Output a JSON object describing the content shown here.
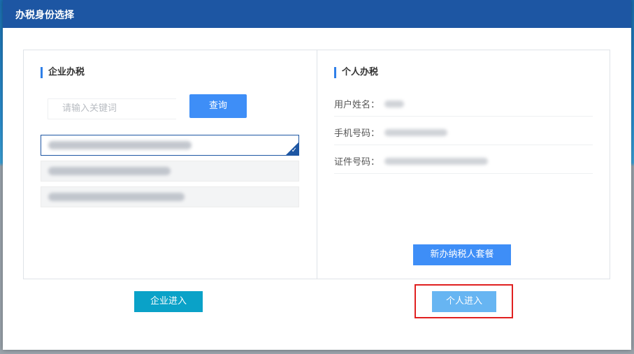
{
  "dialog": {
    "title": "办税身份选择"
  },
  "enterprise_panel": {
    "heading": "企业办税",
    "search_placeholder": "请输入关键词",
    "search_button_label": "查询",
    "companies": [
      {
        "selected": true
      },
      {
        "selected": false
      },
      {
        "selected": false
      }
    ]
  },
  "personal_panel": {
    "heading": "个人办税",
    "fields": [
      {
        "label": "用户姓名："
      },
      {
        "label": "手机号码："
      },
      {
        "label": "证件号码："
      }
    ],
    "new_package_button_label": "新办纳税人套餐"
  },
  "footer": {
    "enterprise_enter_label": "企业进入",
    "personal_enter_label": "个人进入"
  },
  "colors": {
    "title_bar": "#1d56a3",
    "primary_button": "#3e8ef7",
    "enterprise_enter": "#0aa2c8",
    "personal_enter": "#67b5f2",
    "highlight": "#e02020"
  }
}
